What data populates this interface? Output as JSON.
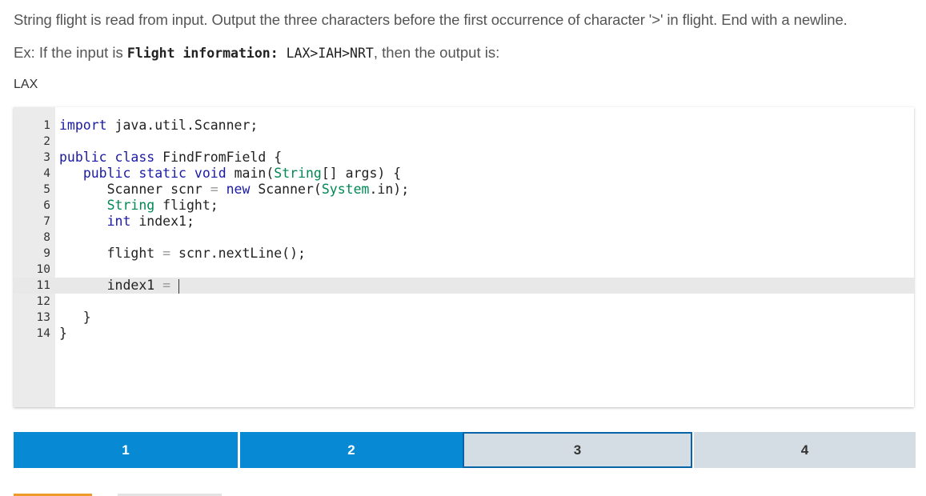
{
  "prompt": "String flight is read from input. Output the three characters before the first occurrence of character '>' in flight. End with a newline.",
  "example": {
    "prefix": "Ex: If the input is ",
    "input_label": "Flight information:",
    "input_value": " LAX>IAH>NRT",
    "suffix": ", then the output is:",
    "output": "LAX"
  },
  "editor": {
    "active_line": 11,
    "lines": [
      {
        "n": "1",
        "text": "import java.util.Scanner;"
      },
      {
        "n": "2",
        "text": ""
      },
      {
        "n": "3",
        "text": "public class FindFromField {"
      },
      {
        "n": "4",
        "text": "   public static void main(String[] args) {"
      },
      {
        "n": "5",
        "text": "      Scanner scnr = new Scanner(System.in);"
      },
      {
        "n": "6",
        "text": "      String flight;"
      },
      {
        "n": "7",
        "text": "      int index1;"
      },
      {
        "n": "8",
        "text": ""
      },
      {
        "n": "9",
        "text": "      flight = scnr.nextLine();"
      },
      {
        "n": "10",
        "text": ""
      },
      {
        "n": "11",
        "text": "      index1 = "
      },
      {
        "n": "12",
        "text": ""
      },
      {
        "n": "13",
        "text": "   }"
      },
      {
        "n": "14",
        "text": "}"
      }
    ]
  },
  "steps": [
    {
      "label": "1",
      "state": "done"
    },
    {
      "label": "2",
      "state": "done"
    },
    {
      "label": "3",
      "state": "current"
    },
    {
      "label": "4",
      "state": "todo"
    }
  ],
  "colors": {
    "step_done": "#0789d4",
    "step_todo": "#d3dde3",
    "step_current_border": "#0864a8",
    "keyword": "#1a1aa6",
    "type": "#008855"
  }
}
